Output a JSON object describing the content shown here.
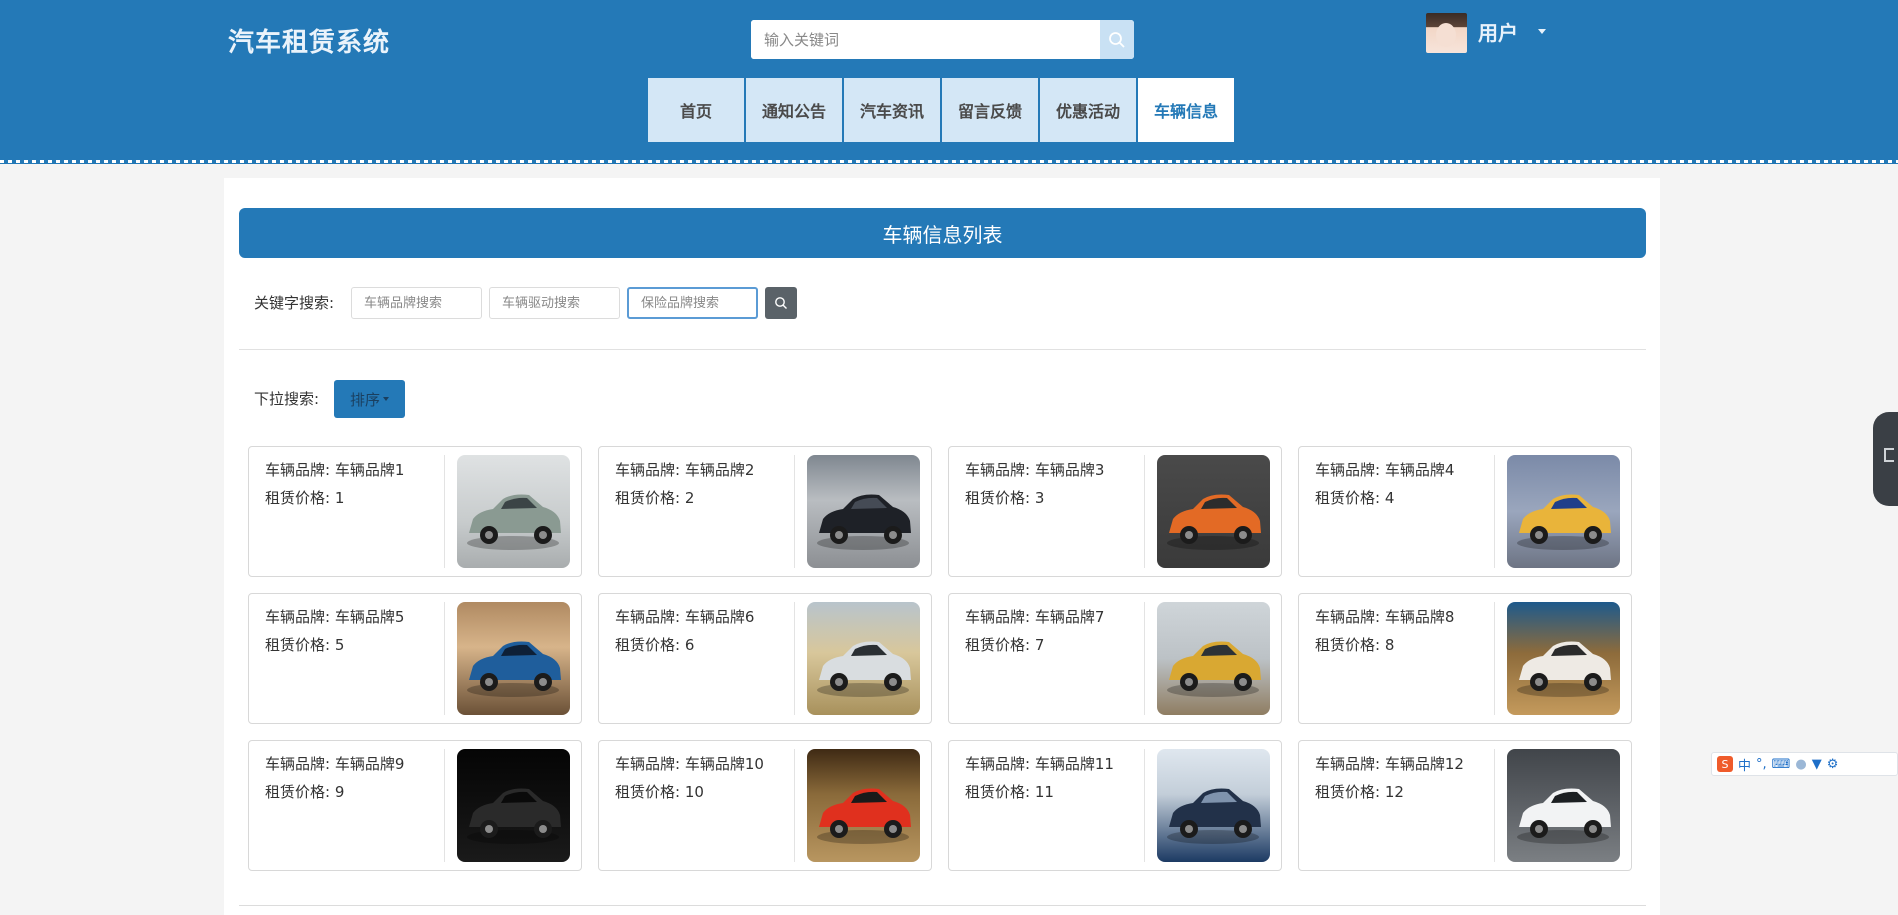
{
  "header": {
    "site_title": "汽车租赁系统",
    "search_placeholder": "输入关键词",
    "user_name": "用户"
  },
  "nav": {
    "items": [
      "首页",
      "通知公告",
      "汽车资讯",
      "留言反馈",
      "优惠活动",
      "车辆信息"
    ],
    "active_index": 5
  },
  "list": {
    "title": "车辆信息列表",
    "keyword_label": "关键字搜索:",
    "brand_placeholder": "车辆品牌搜索",
    "drive_placeholder": "车辆驱动搜索",
    "insurance_placeholder": "保险品牌搜索",
    "dropdown_label": "下拉搜索:",
    "sort_label": "排序"
  },
  "cards": [
    {
      "brand": "车辆品牌: 车辆品牌1",
      "price": "租赁价格: 1",
      "img": "silver-suv"
    },
    {
      "brand": "车辆品牌: 车辆品牌2",
      "price": "租赁价格: 2",
      "img": "dark-sedan"
    },
    {
      "brand": "车辆品牌: 车辆品牌3",
      "price": "租赁价格: 3",
      "img": "orange-hatchback"
    },
    {
      "brand": "车辆品牌: 车辆品牌4",
      "price": "租赁价格: 4",
      "img": "taxi"
    },
    {
      "brand": "车辆品牌: 车辆品牌5",
      "price": "租赁价格: 5",
      "img": "blue-supercar"
    },
    {
      "brand": "车辆品牌: 车辆品牌6",
      "price": "租赁价格: 6",
      "img": "silver-hypercar"
    },
    {
      "brand": "车辆品牌: 车辆品牌7",
      "price": "租赁价格: 7",
      "img": "yellow-taxi"
    },
    {
      "brand": "车辆品牌: 车辆品牌8",
      "price": "租赁价格: 8",
      "img": "white-sports-car"
    },
    {
      "brand": "车辆品牌: 车辆品牌9",
      "price": "租赁价格: 9",
      "img": "black-coupe"
    },
    {
      "brand": "车辆品牌: 车辆品牌10",
      "price": "租赁价格: 10",
      "img": "red-muscle-car"
    },
    {
      "brand": "车辆品牌: 车辆品牌11",
      "price": "租赁价格: 11",
      "img": "van-ad"
    },
    {
      "brand": "车辆品牌: 车辆品牌12",
      "price": "租赁价格: 12",
      "img": "white-suv"
    }
  ],
  "ime": {
    "logo": "S",
    "mode": "中"
  },
  "colors": {
    "primary": "#2479b7",
    "nav_bg": "#d4e7f6",
    "page_bg": "#f4f4f4"
  }
}
